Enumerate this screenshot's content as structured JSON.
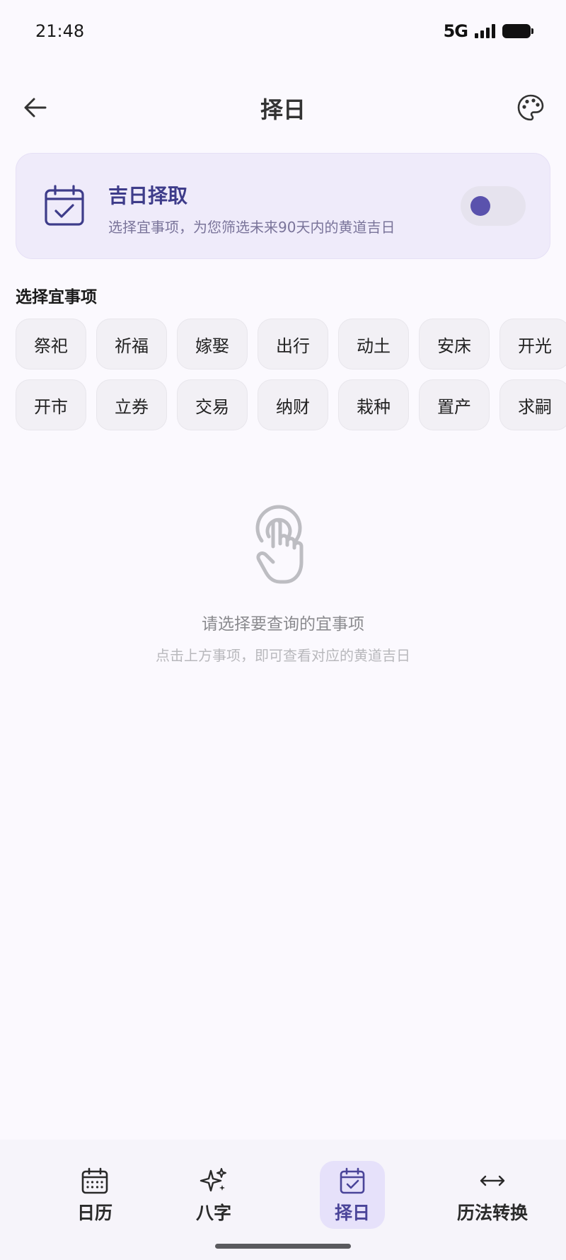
{
  "status_bar": {
    "time": "21:48",
    "network": "5G"
  },
  "header": {
    "title": "择日"
  },
  "feature_card": {
    "title": "吉日择取",
    "description": "选择宜事项，为您筛选未来90天内的黄道吉日",
    "toggle_on": true
  },
  "section": {
    "label": "选择宜事项"
  },
  "chips": {
    "row1": [
      "祭祀",
      "祈福",
      "嫁娶",
      "出行",
      "动土",
      "安床",
      "开光"
    ],
    "row2": [
      "开市",
      "立券",
      "交易",
      "纳财",
      "栽种",
      "置产",
      "求嗣"
    ]
  },
  "empty_state": {
    "title": "请选择要查询的宜事项",
    "subtitle": "点击上方事项，即可查看对应的黄道吉日"
  },
  "bottom_nav": {
    "items": [
      {
        "label": "日历",
        "icon": "calendar-grid-icon",
        "active": false
      },
      {
        "label": "八字",
        "icon": "sparkle-icon",
        "active": false
      },
      {
        "label": "择日",
        "icon": "calendar-check-icon",
        "active": true
      },
      {
        "label": "历法转换",
        "icon": "swap-arrows-icon",
        "active": false
      }
    ]
  },
  "colors": {
    "accent": "#5a52ad",
    "card_bg": "#efebfa",
    "background": "#fbf9fe"
  }
}
